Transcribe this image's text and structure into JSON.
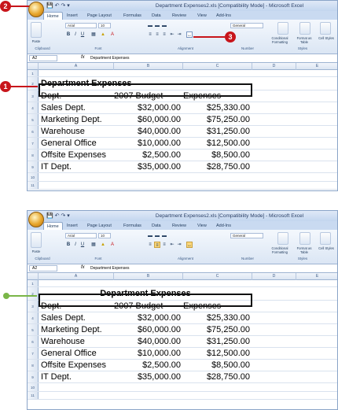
{
  "window": {
    "title": "Department Expenses2.xls [Compatibility Mode] - Microsoft Excel",
    "office_button": "",
    "qat_icons": [
      "save-icon",
      "undo-icon",
      "redo-icon",
      "customize-icon"
    ]
  },
  "tabs": [
    "Home",
    "Insert",
    "Page Layout",
    "Formulas",
    "Data",
    "Review",
    "View",
    "Add-Ins"
  ],
  "ribbon": {
    "groups": [
      "Clipboard",
      "Font",
      "Alignment",
      "Number",
      "Styles"
    ],
    "paste_label": "Paste",
    "font_name": "Arial",
    "font_size": "10",
    "number_format": "General",
    "styles_buttons": [
      {
        "label": "Conditional Formatting"
      },
      {
        "label": "Format as Table"
      },
      {
        "label": "Cell Styles"
      }
    ]
  },
  "formula_bar": {
    "name_box": "A2",
    "fx": "fx",
    "content": "Department Expenses"
  },
  "columns": [
    "A",
    "B",
    "C",
    "D",
    "E"
  ],
  "rows": [
    {
      "num": "1",
      "cells": [
        "",
        "",
        ""
      ]
    },
    {
      "num": "2",
      "cells": [
        "Department Expenses",
        "",
        ""
      ]
    },
    {
      "num": "3",
      "cells": [
        "Dept.",
        "2007 Budget",
        "Expenses"
      ]
    },
    {
      "num": "4",
      "cells": [
        "Sales Dept.",
        "$32,000.00",
        "$25,330.00"
      ]
    },
    {
      "num": "5",
      "cells": [
        "Marketing Dept.",
        "$60,000.00",
        "$75,250.00"
      ]
    },
    {
      "num": "6",
      "cells": [
        "Warehouse",
        "$40,000.00",
        "$31,250.00"
      ]
    },
    {
      "num": "7",
      "cells": [
        "General Office",
        "$10,000.00",
        "$12,500.00"
      ]
    },
    {
      "num": "8",
      "cells": [
        "Offsite Expenses",
        "$2,500.00",
        "$8,500.00"
      ]
    },
    {
      "num": "9",
      "cells": [
        "IT Dept.",
        "$35,000.00",
        "$28,750.00"
      ]
    },
    {
      "num": "10",
      "cells": [
        "",
        "",
        ""
      ]
    },
    {
      "num": "11",
      "cells": [
        "",
        "",
        ""
      ]
    }
  ],
  "callouts": [
    "1",
    "2",
    "3"
  ],
  "colors": {
    "callout": "#c8151b",
    "green": "#7ab648",
    "ribbon": "#dbe6f4"
  }
}
